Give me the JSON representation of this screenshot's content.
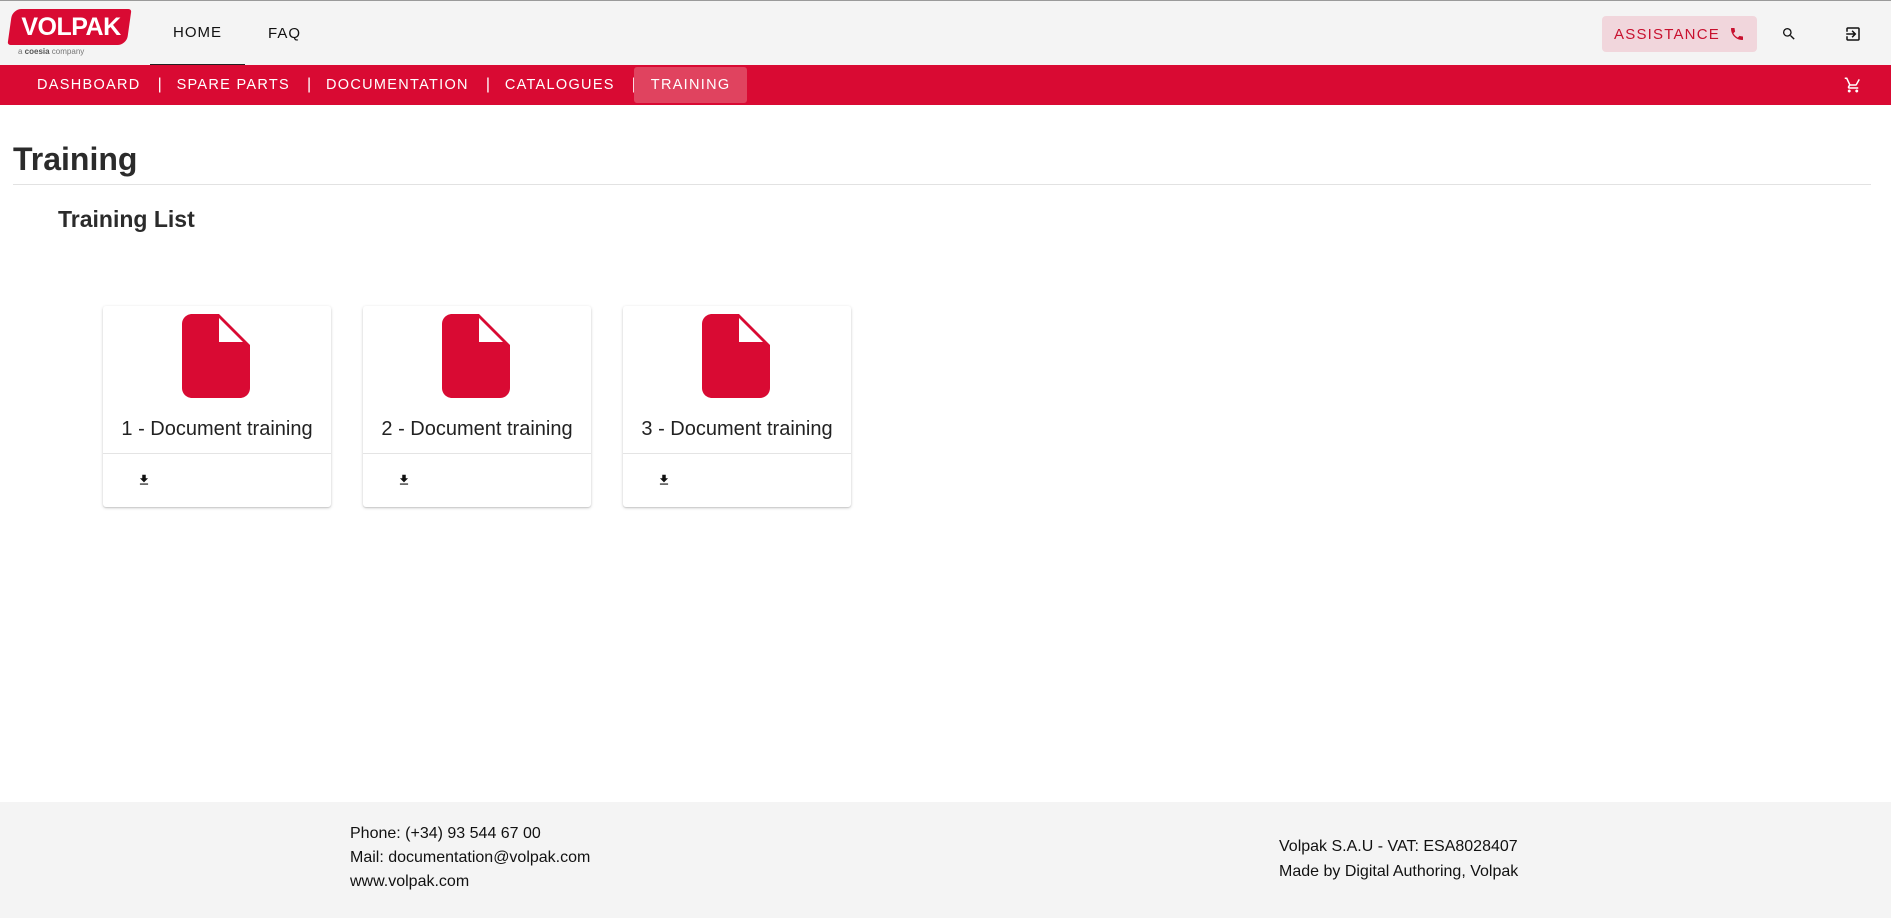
{
  "brand": {
    "name": "VOLPAK",
    "tagline_prefix": "a ",
    "tagline_brand": "coesia",
    "tagline_suffix": " company",
    "accent": "#d90a33"
  },
  "header": {
    "nav": [
      {
        "label": "HOME",
        "active": true
      },
      {
        "label": "FAQ",
        "active": false
      }
    ],
    "assistance_label": "ASSISTANCE",
    "icons": [
      "phone-icon",
      "search-icon",
      "logout-icon"
    ]
  },
  "subnav": {
    "items": [
      {
        "label": "DASHBOARD",
        "active": false
      },
      {
        "label": "SPARE PARTS",
        "active": false
      },
      {
        "label": "DOCUMENTATION",
        "active": false
      },
      {
        "label": "CATALOGUES",
        "active": false
      },
      {
        "label": "TRAINING",
        "active": true
      }
    ],
    "separator": "|",
    "cart_icon": "cart-icon"
  },
  "main": {
    "title": "Training",
    "section_title": "Training List",
    "documents": [
      {
        "title": "1 - Document training",
        "icon": "file-icon",
        "action_icon": "download-icon"
      },
      {
        "title": "2 - Document training",
        "icon": "file-icon",
        "action_icon": "download-icon"
      },
      {
        "title": "3 - Document training",
        "icon": "file-icon",
        "action_icon": "download-icon"
      }
    ]
  },
  "footer": {
    "phone": "Phone: (+34) 93 544 67 00",
    "mail": "Mail: documentation@volpak.com",
    "web": "www.volpak.com",
    "company": "Volpak S.A.U - VAT: ESA8028407",
    "credit": "Made by Digital Authoring, Volpak"
  }
}
